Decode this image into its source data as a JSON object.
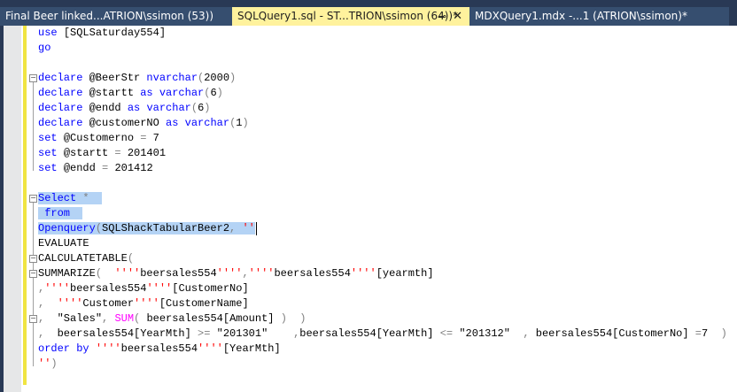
{
  "tabs": [
    {
      "label": "Final Beer linked...ATRION\\ssimon (53))",
      "active": false
    },
    {
      "label": "SQLQuery1.sql - ST...TRION\\ssimon (64))*",
      "active": true,
      "pin_icon": "pin-icon",
      "close_icon": "close-icon"
    },
    {
      "label": "MDXQuery1.mdx -...1 (ATRION\\ssimon)*",
      "active": false
    }
  ],
  "tab_pin_glyph": "⊸",
  "tab_close_glyph": "✕",
  "colors": {
    "keyword": "#0000ff",
    "string": "#ff0000",
    "operator": "#808080",
    "function": "#ff00ff",
    "selection": "#b4d3f5",
    "active_tab": "#fff29d"
  },
  "code_lines": [
    [
      [
        "use ",
        "kw"
      ],
      [
        "[SQLSaturday554]",
        "plain"
      ]
    ],
    [
      [
        "go",
        "kw"
      ]
    ],
    [],
    [
      [
        "declare ",
        "kw"
      ],
      [
        "@BeerStr ",
        "plain"
      ],
      [
        "nvarchar",
        "kw"
      ],
      [
        "(",
        "op"
      ],
      [
        "2000",
        "plain"
      ],
      [
        ")",
        "op"
      ]
    ],
    [
      [
        "declare ",
        "kw"
      ],
      [
        "@startt ",
        "plain"
      ],
      [
        "as ",
        "kw"
      ],
      [
        "varchar",
        "kw"
      ],
      [
        "(",
        "op"
      ],
      [
        "6",
        "plain"
      ],
      [
        ")",
        "op"
      ]
    ],
    [
      [
        "declare ",
        "kw"
      ],
      [
        "@endd ",
        "plain"
      ],
      [
        "as ",
        "kw"
      ],
      [
        "varchar",
        "kw"
      ],
      [
        "(",
        "op"
      ],
      [
        "6",
        "plain"
      ],
      [
        ")",
        "op"
      ]
    ],
    [
      [
        "declare ",
        "kw"
      ],
      [
        "@customerNO ",
        "plain"
      ],
      [
        "as ",
        "kw"
      ],
      [
        "varchar",
        "kw"
      ],
      [
        "(",
        "op"
      ],
      [
        "1",
        "plain"
      ],
      [
        ")",
        "op"
      ]
    ],
    [
      [
        "set ",
        "kw"
      ],
      [
        "@Customerno ",
        "plain"
      ],
      [
        "= ",
        "op"
      ],
      [
        "7",
        "plain"
      ]
    ],
    [
      [
        "set ",
        "kw"
      ],
      [
        "@startt ",
        "plain"
      ],
      [
        "= ",
        "op"
      ],
      [
        "201401",
        "plain"
      ]
    ],
    [
      [
        "set ",
        "kw"
      ],
      [
        "@endd ",
        "plain"
      ],
      [
        "= ",
        "op"
      ],
      [
        "201412",
        "plain"
      ]
    ],
    [],
    [
      [
        "Select ",
        "kw"
      ],
      [
        "*  ",
        "op"
      ]
    ],
    [
      [
        " from  ",
        "kw"
      ]
    ],
    [
      [
        "Openquery",
        "kw"
      ],
      [
        "(",
        "op"
      ],
      [
        "SQLShackTabularBeer2",
        "plain"
      ],
      [
        ", ",
        "op"
      ],
      [
        "''",
        "str"
      ]
    ],
    [
      [
        "EVALUATE",
        "plain"
      ]
    ],
    [
      [
        "CALCULATETABLE",
        "plain"
      ],
      [
        "(",
        "op"
      ]
    ],
    [
      [
        "SUMMARIZE",
        "plain"
      ],
      [
        "(  ",
        "op"
      ],
      [
        "''''",
        "str"
      ],
      [
        "beersales554",
        "plain"
      ],
      [
        "''''",
        "str"
      ],
      [
        ",",
        "op"
      ],
      [
        "''''",
        "str"
      ],
      [
        "beersales554",
        "plain"
      ],
      [
        "''''",
        "str"
      ],
      [
        "[yearmth]",
        "plain"
      ]
    ],
    [
      [
        ",",
        "op"
      ],
      [
        "''''",
        "str"
      ],
      [
        "beersales554",
        "plain"
      ],
      [
        "''''",
        "str"
      ],
      [
        "[CustomerNo]",
        "plain"
      ]
    ],
    [
      [
        ",  ",
        "op"
      ],
      [
        "''''",
        "str"
      ],
      [
        "Customer",
        "plain"
      ],
      [
        "''''",
        "str"
      ],
      [
        "[CustomerName]",
        "plain"
      ]
    ],
    [
      [
        ",  ",
        "op"
      ],
      [
        "\"Sales\"",
        "plain"
      ],
      [
        ", ",
        "op"
      ],
      [
        "SUM",
        "fn"
      ],
      [
        "( ",
        "op"
      ],
      [
        "beersales554[Amount] ",
        "plain"
      ],
      [
        ")  )",
        "op"
      ]
    ],
    [
      [
        ",  ",
        "op"
      ],
      [
        "beersales554[YearMth] ",
        "plain"
      ],
      [
        ">= ",
        "op"
      ],
      [
        "\"201301\"    ",
        "plain"
      ],
      [
        ",",
        "op"
      ],
      [
        "beersales554[YearMth] ",
        "plain"
      ],
      [
        "<= ",
        "op"
      ],
      [
        "\"201312\"  ",
        "plain"
      ],
      [
        ", ",
        "op"
      ],
      [
        "beersales554[CustomerNo] ",
        "plain"
      ],
      [
        "=",
        "op"
      ],
      [
        "7  ",
        "plain"
      ],
      [
        ")",
        "op"
      ]
    ],
    [
      [
        "order by ",
        "kw"
      ],
      [
        "''''",
        "str"
      ],
      [
        "beersales554",
        "plain"
      ],
      [
        "''''",
        "str"
      ],
      [
        "[YearMth]",
        "plain"
      ]
    ],
    [
      [
        "''",
        "str"
      ],
      [
        ")",
        "op"
      ]
    ]
  ]
}
